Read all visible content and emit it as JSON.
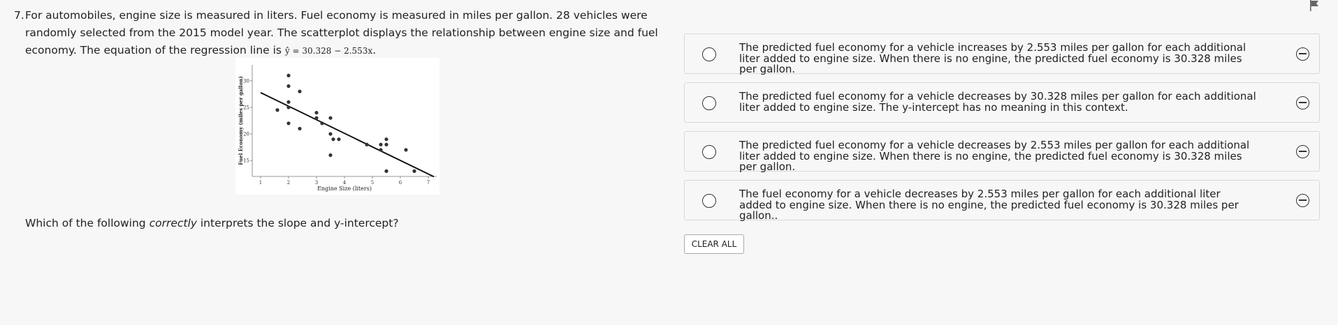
{
  "question": {
    "number": "7.",
    "text": "For automobiles, engine size is measured in liters. Fuel economy is measured in miles per gallon. 28 vehicles were randomly selected from the 2015 model year. The scatterplot displays the relationship between engine size and fuel economy. The equation of the regression line is ",
    "equation": "ŷ = 30.328 − 2.553x",
    "end": ".",
    "prompt_pre": "Which of the following ",
    "prompt_em": "correctly",
    "prompt_post": " interprets the slope and y-intercept?"
  },
  "choices": [
    {
      "text": "The predicted fuel economy for a vehicle increases by 2.553 miles per gallon for each additional liter added to engine size. When there is no engine, the predicted fuel economy is 30.328 miles per gallon."
    },
    {
      "text": "The predicted fuel economy for a vehicle decreases by 30.328 miles per gallon for each additional liter added to engine size. The y-intercept has no meaning in this context."
    },
    {
      "text": "The predicted fuel economy for a vehicle decreases by 2.553 miles per gallon for each additional liter added to engine size. When there is no engine, the predicted fuel economy is 30.328 miles per gallon."
    },
    {
      "text": "The fuel economy for a vehicle decreases by 2.553 miles per gallon for each additional liter added to engine size. When there is no engine, the predicted fuel economy is 30.328 miles per gallon.."
    }
  ],
  "clear_label": "CLEAR ALL",
  "icons": {
    "radio": "radio-button-icon",
    "eliminate": "eliminate-choice-icon",
    "flag": "flag-icon"
  },
  "chart_data": {
    "type": "scatter",
    "xlabel": "Engine Size (liters)",
    "ylabel": "Fuel Economy (miles per gallon)",
    "xticks": [
      "1",
      "2",
      "3",
      "4",
      "5",
      "6",
      "7"
    ],
    "yticks": [
      "15",
      "20",
      "25",
      "30"
    ],
    "xlim": [
      0.7,
      7.3
    ],
    "ylim": [
      12,
      33
    ],
    "points": [
      [
        1.6,
        24.5
      ],
      [
        2.0,
        31.0
      ],
      [
        2.0,
        29.0
      ],
      [
        2.0,
        26.0
      ],
      [
        2.0,
        25.0
      ],
      [
        2.0,
        22.0
      ],
      [
        2.4,
        28.0
      ],
      [
        2.4,
        21.0
      ],
      [
        3.0,
        24.0
      ],
      [
        3.0,
        23.0
      ],
      [
        3.2,
        22.0
      ],
      [
        3.5,
        23.0
      ],
      [
        3.5,
        20.0
      ],
      [
        3.5,
        16.0
      ],
      [
        3.6,
        19.0
      ],
      [
        3.8,
        19.0
      ],
      [
        4.8,
        18.0
      ],
      [
        5.3,
        18.0
      ],
      [
        5.3,
        17.0
      ],
      [
        5.5,
        19.0
      ],
      [
        5.5,
        18.0
      ],
      [
        5.5,
        13.0
      ],
      [
        6.2,
        17.0
      ],
      [
        6.5,
        13.0
      ]
    ],
    "regression": {
      "intercept": 30.328,
      "slope": -2.553,
      "x_start": 1.0,
      "x_end": 7.2
    },
    "grid": false
  }
}
